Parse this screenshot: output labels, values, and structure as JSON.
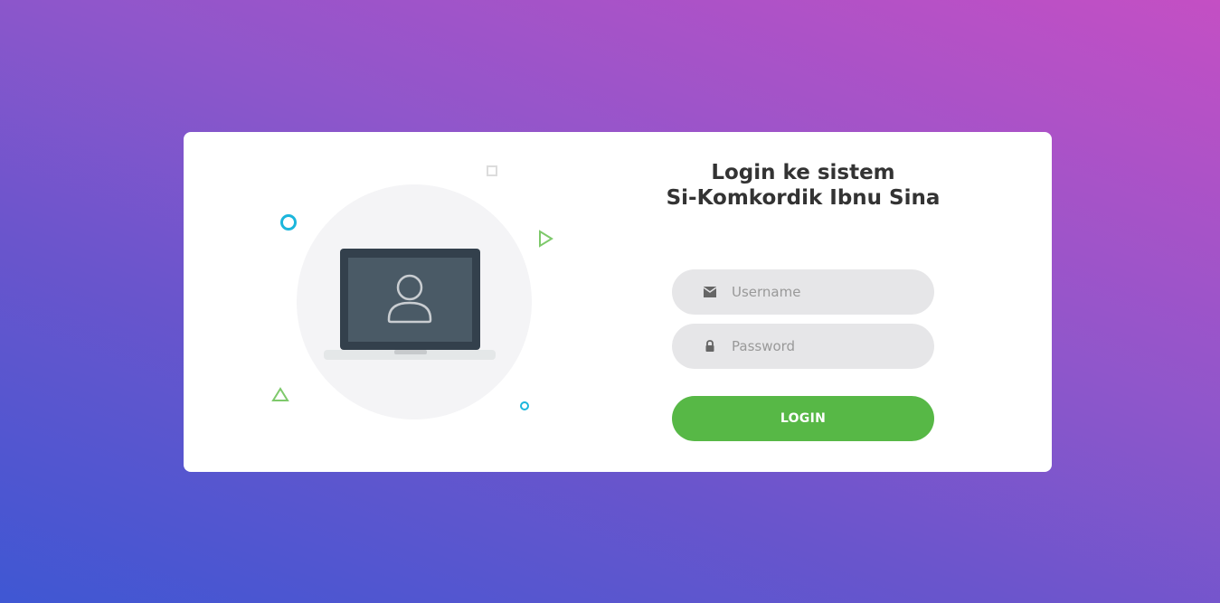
{
  "login": {
    "title_line1": "Login ke sistem",
    "title_line2": "Si-Komkordik Ibnu Sina",
    "username_placeholder": "Username",
    "password_placeholder": "Password",
    "button_label": "LOGIN"
  },
  "icons": {
    "username": "envelope-icon",
    "password": "lock-icon",
    "illustration": "laptop-user-icon"
  },
  "colors": {
    "accent": "#57b846",
    "decoration_blue": "#1bb6dc",
    "decoration_green": "#7ec96b",
    "background_start": "#3f57d3",
    "background_end": "#c44fc4"
  }
}
